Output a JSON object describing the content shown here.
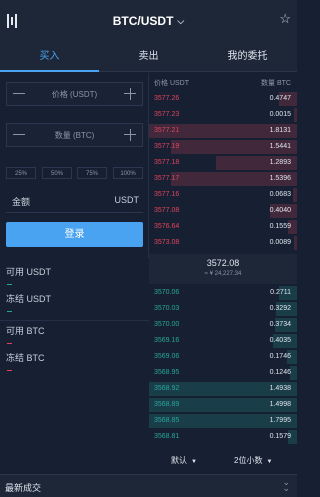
{
  "header": {
    "pair": "BTC/USDT",
    "logo_icon": "chart-bars-icon",
    "star_icon": "star-icon"
  },
  "tabs": [
    {
      "label": "买入",
      "active": true
    },
    {
      "label": "卖出",
      "active": false
    },
    {
      "label": "我的委托",
      "active": false
    }
  ],
  "form": {
    "price_placeholder": "价格 (USDT)",
    "quantity_placeholder": "数量 (BTC)",
    "percents": [
      "25%",
      "50%",
      "75%",
      "100%"
    ],
    "amount_label": "金额",
    "amount_unit": "USDT",
    "login_label": "登录"
  },
  "balances": [
    {
      "label": "可用 USDT",
      "value": "--",
      "color": "#26a69a"
    },
    {
      "label": "冻结 USDT",
      "value": "--",
      "color": "#26a69a"
    },
    {
      "label": "可用 BTC",
      "value": "--",
      "color": "#e0435a"
    },
    {
      "label": "冻结 BTC",
      "value": "--",
      "color": "#e0435a"
    }
  ],
  "orderbook": {
    "price_header": "价格 USDT",
    "qty_header": "数量 BTC",
    "asks": [
      {
        "price": "3577.26",
        "qty": "0.4747",
        "depth": 0.12
      },
      {
        "price": "3577.23",
        "qty": "0.0015",
        "depth": 0.02
      },
      {
        "price": "3577.21",
        "qty": "1.8131",
        "depth": 1.0
      },
      {
        "price": "3577.19",
        "qty": "1.5441",
        "depth": 0.85
      },
      {
        "price": "3577.18",
        "qty": "1.2893",
        "depth": 0.55
      },
      {
        "price": "3577.17",
        "qty": "1.5396",
        "depth": 0.85
      },
      {
        "price": "3577.16",
        "qty": "0.0683",
        "depth": 0.03
      },
      {
        "price": "3577.08",
        "qty": "0.4040",
        "depth": 0.18
      },
      {
        "price": "3576.64",
        "qty": "0.1559",
        "depth": 0.06
      },
      {
        "price": "3573.08",
        "qty": "0.0089",
        "depth": 0.02
      }
    ],
    "last_price": "3572.08",
    "last_price_cny": "≈ ¥ 24,227.34",
    "bids": [
      {
        "price": "3570.06",
        "qty": "0.2711",
        "depth": 0.12
      },
      {
        "price": "3570.03",
        "qty": "0.3292",
        "depth": 0.14
      },
      {
        "price": "3570.00",
        "qty": "0.3734",
        "depth": 0.15
      },
      {
        "price": "3569.16",
        "qty": "0.4035",
        "depth": 0.16
      },
      {
        "price": "3569.06",
        "qty": "0.1746",
        "depth": 0.07
      },
      {
        "price": "3568.95",
        "qty": "0.1246",
        "depth": 0.05
      },
      {
        "price": "3568.92",
        "qty": "1.4938",
        "depth": 1.0
      },
      {
        "price": "3568.89",
        "qty": "1.4998",
        "depth": 1.0
      },
      {
        "price": "3568.85",
        "qty": "1.7995",
        "depth": 1.0
      },
      {
        "price": "3568.81",
        "qty": "0.1579",
        "depth": 0.06
      }
    ],
    "mode_select": "默认",
    "precision_select": "2位小数"
  },
  "footer": {
    "title": "最新成交",
    "expand_icon": "double-chevron-down-icon"
  },
  "colors": {
    "ask": "#e0435a",
    "bid": "#26a69a",
    "accent": "#4aa3f0"
  }
}
